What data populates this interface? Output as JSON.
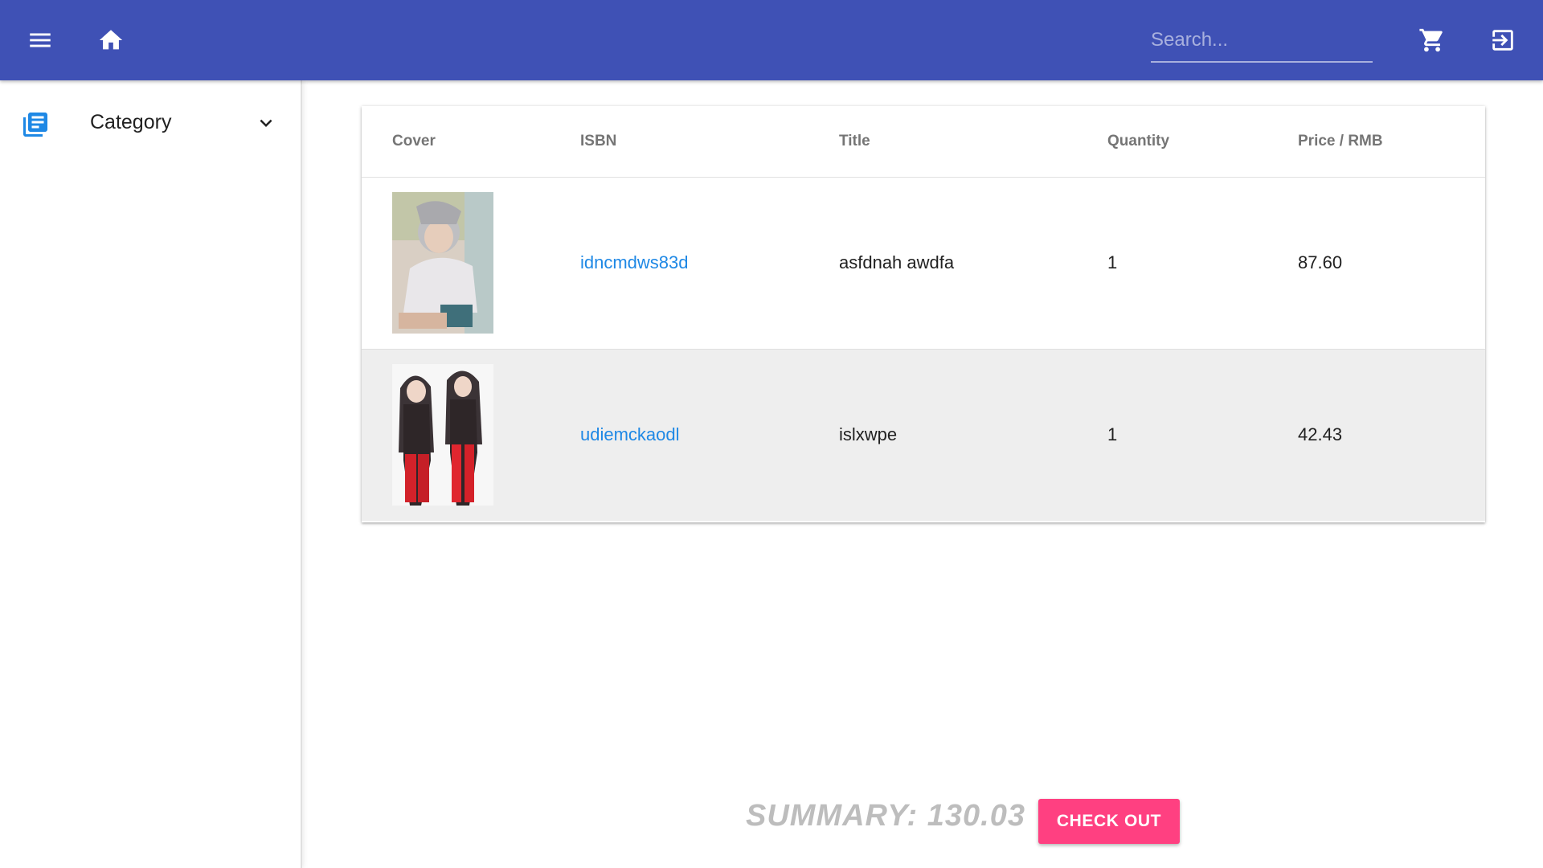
{
  "header": {
    "search_placeholder": "Search..."
  },
  "sidebar": {
    "items": [
      {
        "label": "Category",
        "icon": "library-books-icon"
      }
    ]
  },
  "table": {
    "columns": [
      "Cover",
      "ISBN",
      "Title",
      "Quantity",
      "Price / RMB"
    ],
    "rows": [
      {
        "isbn": "idncmdws83d",
        "title": "asfdnah awdfa",
        "quantity": "1",
        "price": "87.60"
      },
      {
        "isbn": "udiemckaodl",
        "title": "islxwpe",
        "quantity": "1",
        "price": "42.43"
      }
    ]
  },
  "summary": {
    "text": "SUMMARY: 130.03",
    "checkout_label": "CHECK OUT"
  },
  "colors": {
    "primary": "#3f51b5",
    "accent": "#ff4081",
    "link": "#1e88e5"
  }
}
